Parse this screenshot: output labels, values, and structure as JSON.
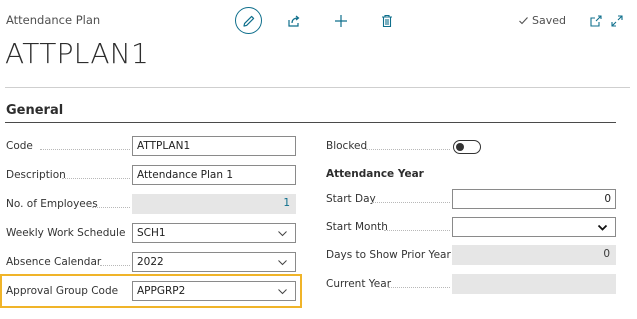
{
  "header": {
    "caption": "Attendance Plan",
    "title": "ATTPLAN1",
    "saved_label": "Saved"
  },
  "section": {
    "title": "General"
  },
  "left_fields": [
    {
      "label": "Code",
      "value": "ATTPLAN1",
      "type": "text"
    },
    {
      "label": "Description",
      "value": "Attendance Plan 1",
      "type": "text"
    },
    {
      "label": "No. of Employees",
      "value": "1",
      "type": "readonly"
    },
    {
      "label": "Weekly Work Schedule",
      "value": "SCH1",
      "type": "dropdown"
    },
    {
      "label": "Absence Calendar",
      "value": "2022",
      "type": "dropdown"
    },
    {
      "label": "Approval Group Code",
      "value": "APPGRP2",
      "type": "dropdown"
    }
  ],
  "right": {
    "blocked_label": "Blocked",
    "blocked_on": false,
    "subheading": "Attendance Year",
    "fields": [
      {
        "label": "Start Day",
        "value": "0",
        "type": "number"
      },
      {
        "label": "Start Month",
        "value": "",
        "type": "select"
      },
      {
        "label": "Days to Show Prior Year",
        "value": "0",
        "type": "readonly"
      },
      {
        "label": "Current Year",
        "value": "",
        "type": "readonly"
      }
    ]
  },
  "colors": {
    "accent": "#0f6f8c",
    "highlight": "#f0b429"
  }
}
